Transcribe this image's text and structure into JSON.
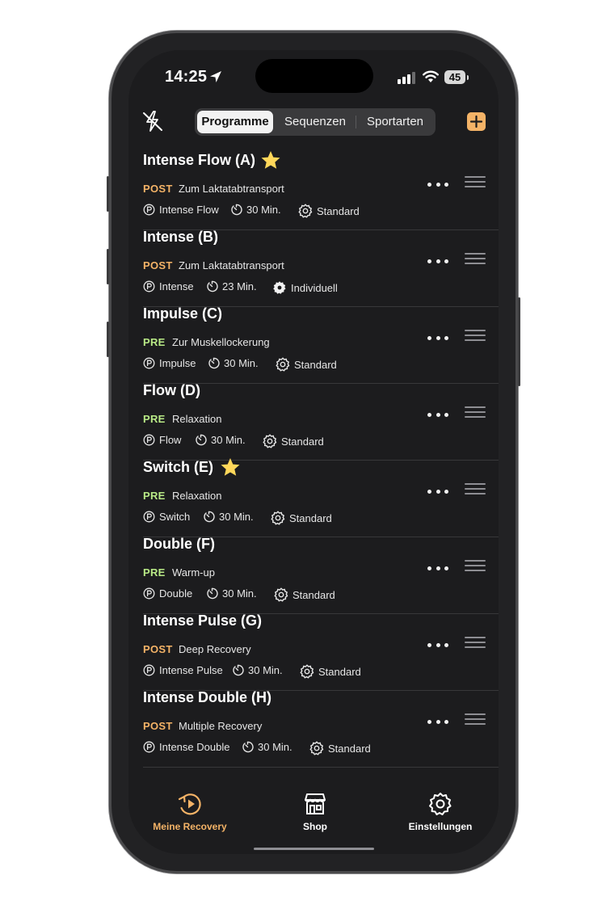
{
  "status_bar": {
    "time": "14:25",
    "battery": "45"
  },
  "header": {
    "segments": [
      "Programme",
      "Sequenzen",
      "Sportarten"
    ],
    "active_segment": "Programme"
  },
  "colors": {
    "accent": "#f4b367",
    "post": "#f4b367",
    "pre": "#b8e986",
    "star": "#ffd75a",
    "background": "#1c1c1e"
  },
  "programs": [
    {
      "title": "Intense Flow (A)",
      "favorite": true,
      "tag": "POST",
      "subtitle": "Zum Laktatabtransport",
      "program": "Intense Flow",
      "duration": "30 Min.",
      "mode": "Standard",
      "mode_icon": "gear-outline-icon"
    },
    {
      "title": "Intense (B)",
      "favorite": false,
      "tag": "POST",
      "subtitle": "Zum Laktatabtransport",
      "program": "Intense",
      "duration": "23 Min.",
      "mode": "Individuell",
      "mode_icon": "gear-filled-icon"
    },
    {
      "title": "Impulse (C)",
      "favorite": false,
      "tag": "PRE",
      "subtitle": "Zur Muskellockerung",
      "program": "Impulse",
      "duration": "30 Min.",
      "mode": "Standard",
      "mode_icon": "gear-outline-icon"
    },
    {
      "title": "Flow (D)",
      "favorite": false,
      "tag": "PRE",
      "subtitle": "Relaxation",
      "program": "Flow",
      "duration": "30 Min.",
      "mode": "Standard",
      "mode_icon": "gear-outline-icon"
    },
    {
      "title": "Switch (E)",
      "favorite": true,
      "tag": "PRE",
      "subtitle": "Relaxation",
      "program": "Switch",
      "duration": "30 Min.",
      "mode": "Standard",
      "mode_icon": "gear-outline-icon"
    },
    {
      "title": "Double (F)",
      "favorite": false,
      "tag": "PRE",
      "subtitle": "Warm-up",
      "program": "Double",
      "duration": "30 Min.",
      "mode": "Standard",
      "mode_icon": "gear-outline-icon"
    },
    {
      "title": "Intense Pulse (G)",
      "favorite": false,
      "tag": "POST",
      "subtitle": "Deep Recovery",
      "program": "Intense Pulse",
      "duration": "30 Min.",
      "mode": "Standard",
      "mode_icon": "gear-outline-icon"
    },
    {
      "title": "Intense Double (H)",
      "favorite": false,
      "tag": "POST",
      "subtitle": "Multiple Recovery",
      "program": "Intense Double",
      "duration": "30 Min.",
      "mode": "Standard",
      "mode_icon": "gear-outline-icon"
    }
  ],
  "tab_bar": [
    {
      "label": "Meine Recovery",
      "icon": "recovery-play-icon",
      "active": true
    },
    {
      "label": "Shop",
      "icon": "store-icon",
      "active": false
    },
    {
      "label": "Einstellungen",
      "icon": "gear-icon",
      "active": false
    }
  ]
}
